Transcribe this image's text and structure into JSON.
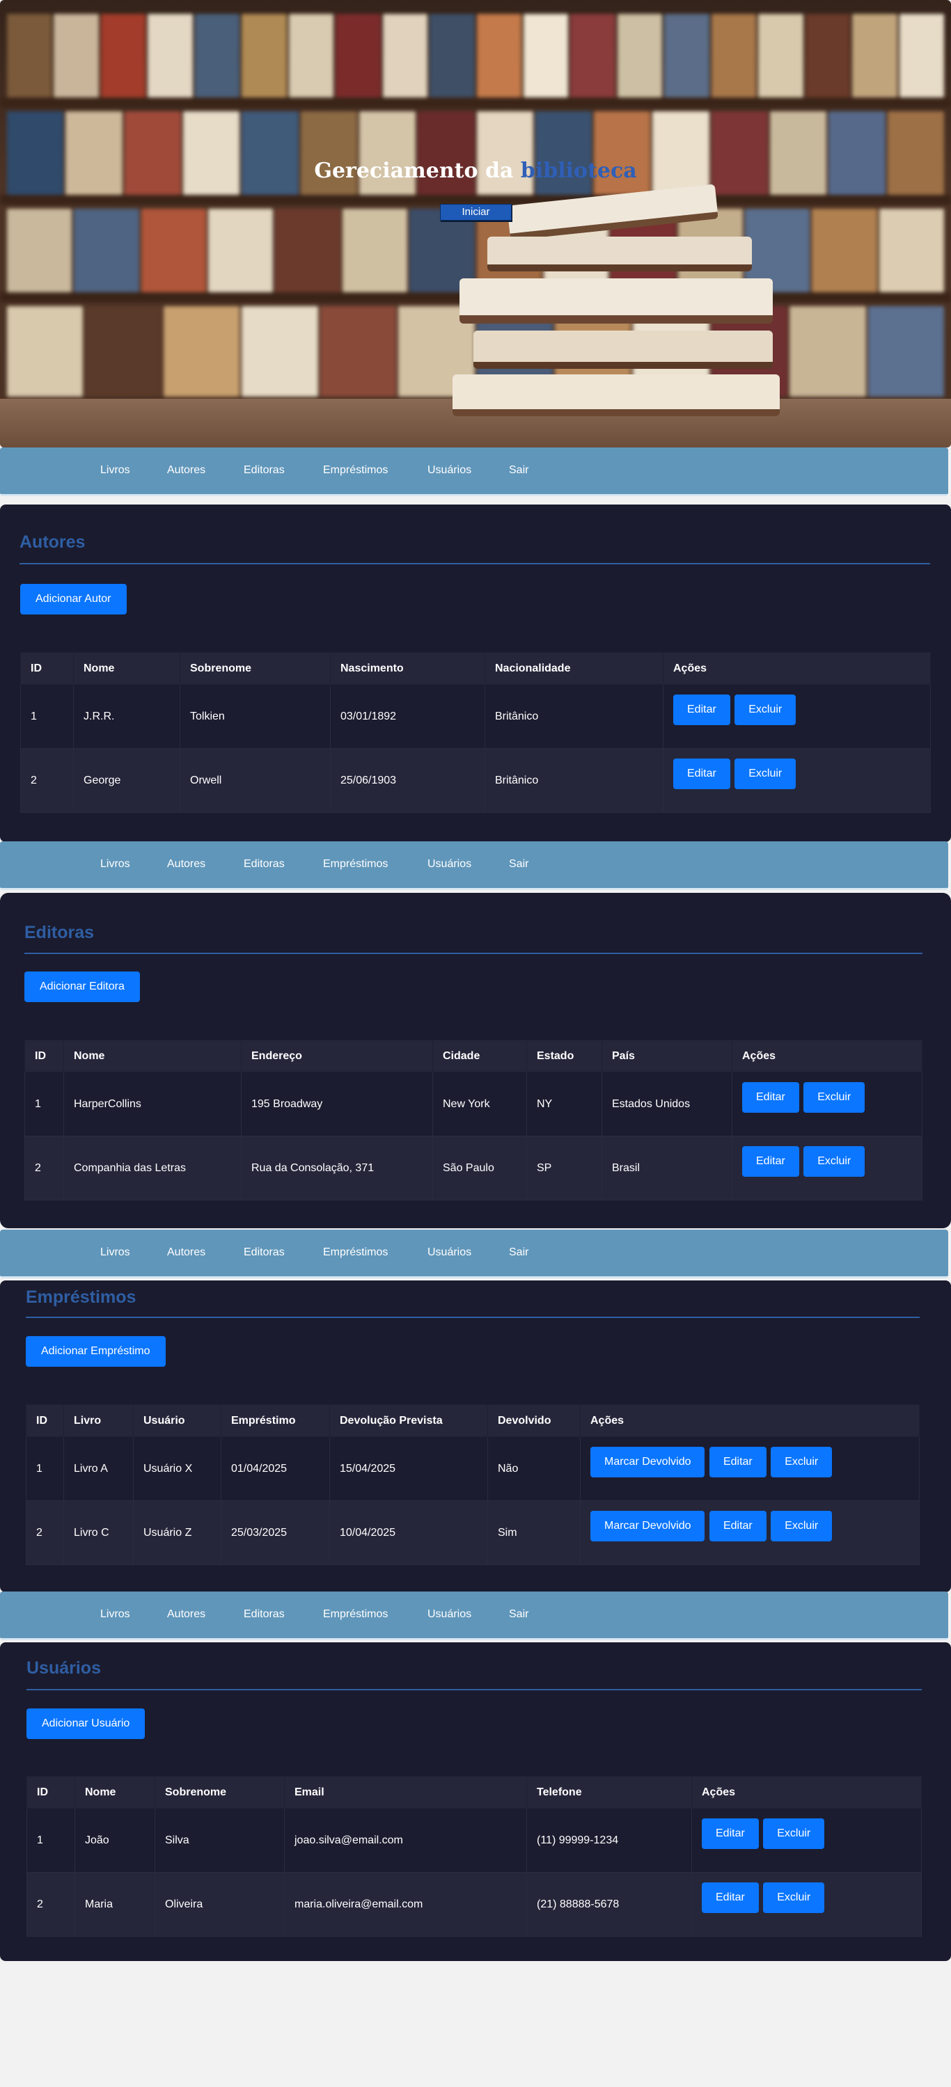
{
  "hero": {
    "title_main": "Gereciamento da",
    "title_accent": "biblioteca",
    "button_label": "Iniciar"
  },
  "nav": {
    "items": [
      "Livros",
      "Autores",
      "Editoras",
      "Empréstimos",
      "Usuários",
      "Sair"
    ]
  },
  "autores": {
    "title": "Autores",
    "add_label": "Adicionar Autor",
    "headers": [
      "ID",
      "Nome",
      "Sobrenome",
      "Nascimento",
      "Nacionalidade",
      "Ações"
    ],
    "rows": [
      [
        "1",
        "J.R.R.",
        "Tolkien",
        "03/01/1892",
        "Britânico"
      ],
      [
        "2",
        "George",
        "Orwell",
        "25/06/1903",
        "Britânico"
      ]
    ]
  },
  "editoras": {
    "title": "Editoras",
    "add_label": "Adicionar Editora",
    "headers": [
      "ID",
      "Nome",
      "Endereço",
      "Cidade",
      "Estado",
      "País",
      "Ações"
    ],
    "rows": [
      [
        "1",
        "HarperCollins",
        "195 Broadway",
        "New York",
        "NY",
        "Estados Unidos"
      ],
      [
        "2",
        "Companhia das Letras",
        "Rua da Consolação, 371",
        "São Paulo",
        "SP",
        "Brasil"
      ]
    ]
  },
  "emprestimos": {
    "title": "Empréstimos",
    "add_label": "Adicionar Empréstimo",
    "headers": [
      "ID",
      "Livro",
      "Usuário",
      "Empréstimo",
      "Devolução Prevista",
      "Devolvido",
      "Ações"
    ],
    "rows": [
      [
        "1",
        "Livro A",
        "Usuário X",
        "01/04/2025",
        "15/04/2025",
        "Não"
      ],
      [
        "2",
        "Livro C",
        "Usuário Z",
        "25/03/2025",
        "10/04/2025",
        "Sim"
      ]
    ],
    "mark_returned_label": "Marcar Devolvido"
  },
  "usuarios": {
    "title": "Usuários",
    "add_label": "Adicionar Usuário",
    "headers": [
      "ID",
      "Nome",
      "Sobrenome",
      "Email",
      "Telefone",
      "Ações"
    ],
    "rows": [
      [
        "1",
        "João",
        "Silva",
        "joao.silva@email.com",
        "(11) 99999-1234"
      ],
      [
        "2",
        "Maria",
        "Oliveira",
        "maria.oliveira@email.com",
        "(21) 88888-5678"
      ]
    ]
  },
  "actions": {
    "edit_label": "Editar",
    "delete_label": "Excluir"
  },
  "colors": {
    "accent": "#0b76ff",
    "nav": "#6096ba",
    "section_bg": "#1a1b2e",
    "title": "#2f5ea3"
  }
}
